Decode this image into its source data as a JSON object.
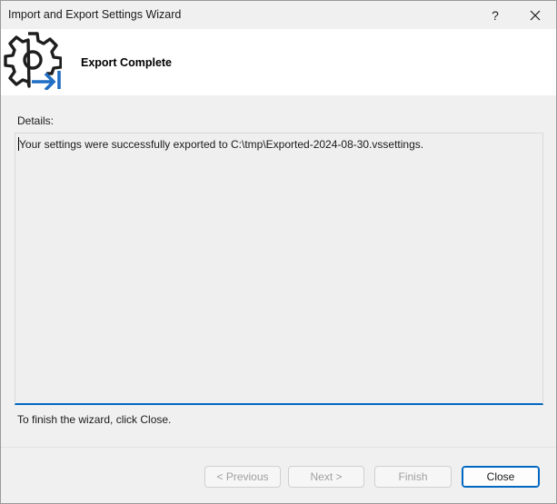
{
  "window": {
    "title": "Import and Export Settings Wizard",
    "help_glyph": "?",
    "close_icon": "close-icon"
  },
  "header": {
    "title": "Export Complete",
    "icon": "gear-export-icon",
    "colors": {
      "gear": "#1e1e1e",
      "arrow": "#1f6fc4"
    }
  },
  "details": {
    "label": "Details:",
    "text": "Your settings were successfully exported to C:\\tmp\\Exported-2024-08-30.vssettings."
  },
  "instruction": "To finish the wizard, click Close.",
  "buttons": {
    "previous": "< Previous",
    "next": "Next >",
    "finish": "Finish",
    "close": "Close"
  },
  "colors": {
    "accent": "#0067c0",
    "header_bg": "#ffffff",
    "body_bg": "#f0f0f0",
    "disabled_text": "#a0a0a0"
  }
}
